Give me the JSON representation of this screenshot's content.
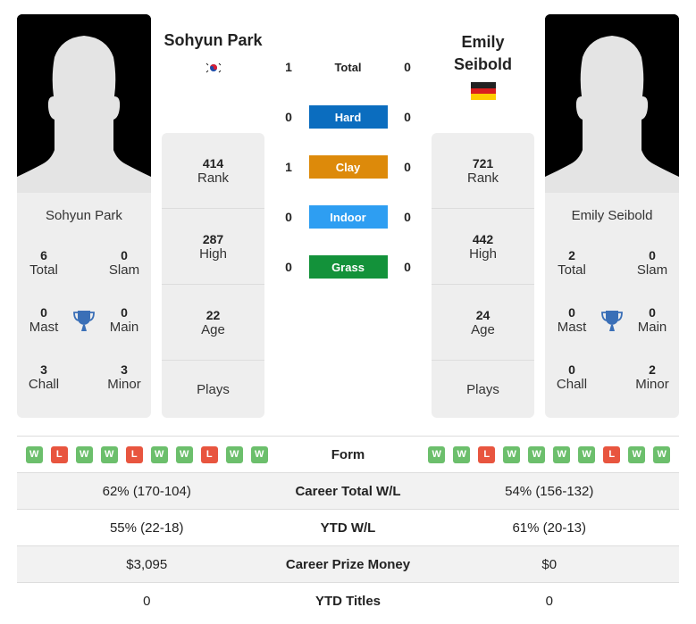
{
  "colors": {
    "hard": "#0b6dbf",
    "clay": "#dd8a0a",
    "indoor": "#2e9ef2",
    "grass": "#13923a",
    "win": "#6cbf6c",
    "loss": "#e8553f",
    "trophy": "#3a6fb7"
  },
  "player1": {
    "name": "Sohyun Park",
    "flag": "south-korea",
    "rank": "414",
    "rank_label": "Rank",
    "high": "287",
    "high_label": "High",
    "age": "22",
    "age_label": "Age",
    "plays_label": "Plays",
    "titles": {
      "total": "6",
      "total_label": "Total",
      "slam": "0",
      "slam_label": "Slam",
      "mast": "0",
      "mast_label": "Mast",
      "main": "0",
      "main_label": "Main",
      "chall": "3",
      "chall_label": "Chall",
      "minor": "3",
      "minor_label": "Minor"
    },
    "form": [
      "W",
      "L",
      "W",
      "W",
      "L",
      "W",
      "W",
      "L",
      "W",
      "W"
    ]
  },
  "player2": {
    "name_line1": "Emily",
    "name_line2": "Seibold",
    "name": "Emily Seibold",
    "flag": "germany",
    "rank": "721",
    "rank_label": "Rank",
    "high": "442",
    "high_label": "High",
    "age": "24",
    "age_label": "Age",
    "plays_label": "Plays",
    "titles": {
      "total": "2",
      "total_label": "Total",
      "slam": "0",
      "slam_label": "Slam",
      "mast": "0",
      "mast_label": "Mast",
      "main": "0",
      "main_label": "Main",
      "chall": "0",
      "chall_label": "Chall",
      "minor": "2",
      "minor_label": "Minor"
    },
    "form": [
      "W",
      "W",
      "L",
      "W",
      "W",
      "W",
      "W",
      "L",
      "W",
      "W"
    ]
  },
  "h2h": [
    {
      "label": "Total",
      "p1": "1",
      "p2": "0"
    },
    {
      "label": "Hard",
      "p1": "0",
      "p2": "0"
    },
    {
      "label": "Clay",
      "p1": "1",
      "p2": "0"
    },
    {
      "label": "Indoor",
      "p1": "0",
      "p2": "0"
    },
    {
      "label": "Grass",
      "p1": "0",
      "p2": "0"
    }
  ],
  "comparison": {
    "form_label": "Form",
    "rows": [
      {
        "label": "Career Total W/L",
        "p1": "62% (170-104)",
        "p2": "54% (156-132)"
      },
      {
        "label": "YTD W/L",
        "p1": "55% (22-18)",
        "p2": "61% (20-13)"
      },
      {
        "label": "Career Prize Money",
        "p1": "$3,095",
        "p2": "$0"
      },
      {
        "label": "YTD Titles",
        "p1": "0",
        "p2": "0"
      }
    ]
  }
}
